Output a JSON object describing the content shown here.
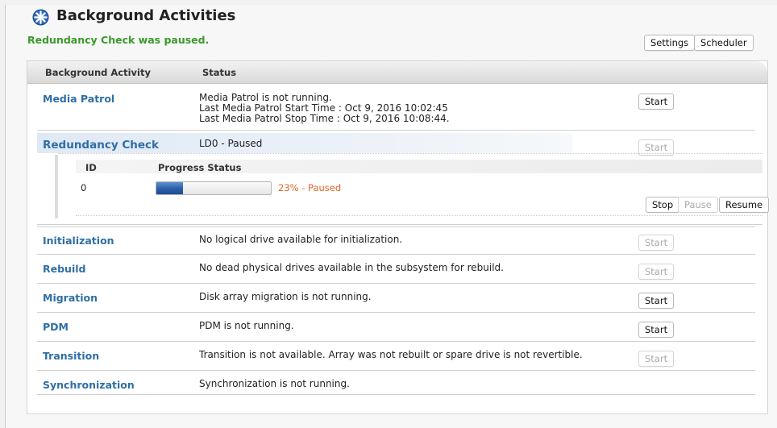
{
  "header": {
    "title": "Background Activities",
    "status_message": "Redundancy Check was paused.",
    "settings_label": "Settings",
    "scheduler_label": "Scheduler"
  },
  "table": {
    "col_activity": "Background Activity",
    "col_status": "Status"
  },
  "activities": {
    "media_patrol": {
      "name": "Media Patrol",
      "line1": "Media Patrol is not running.",
      "line2": "Last Media Patrol Start Time : Oct 9, 2016 10:02:45",
      "line3": "Last Media Patrol Stop Time : Oct 9, 2016 10:08:44.",
      "button": "Start"
    },
    "redundancy_check": {
      "name": "Redundancy Check",
      "status": "LD0 - Paused",
      "button": "Start",
      "sub_col_id": "ID",
      "sub_col_progress": "Progress Status",
      "row_id": "0",
      "progress_percent": 23,
      "progress_text": "23% - Paused",
      "stop_label": "Stop",
      "pause_label": "Pause",
      "resume_label": "Resume"
    },
    "initialization": {
      "name": "Initialization",
      "status": "No logical drive available for initialization.",
      "button": "Start"
    },
    "rebuild": {
      "name": "Rebuild",
      "status": "No dead physical drives available in the subsystem for rebuild.",
      "button": "Start"
    },
    "migration": {
      "name": "Migration",
      "status": "Disk array migration is not running.",
      "button": "Start"
    },
    "pdm": {
      "name": "PDM",
      "status": "PDM is not running.",
      "button": "Start"
    },
    "transition": {
      "name": "Transition",
      "status": "Transition is not available. Array was not rebuilt or spare drive is not revertible.",
      "button": "Start"
    },
    "synchronization": {
      "name": "Synchronization",
      "status": "Synchronization is not running."
    }
  },
  "colors": {
    "accent_link": "#2f6ea5",
    "success": "#3a9a2a",
    "warning": "#e1662a",
    "progress": "#2b5ea8"
  },
  "icons": {
    "header": "background-activity-icon"
  }
}
